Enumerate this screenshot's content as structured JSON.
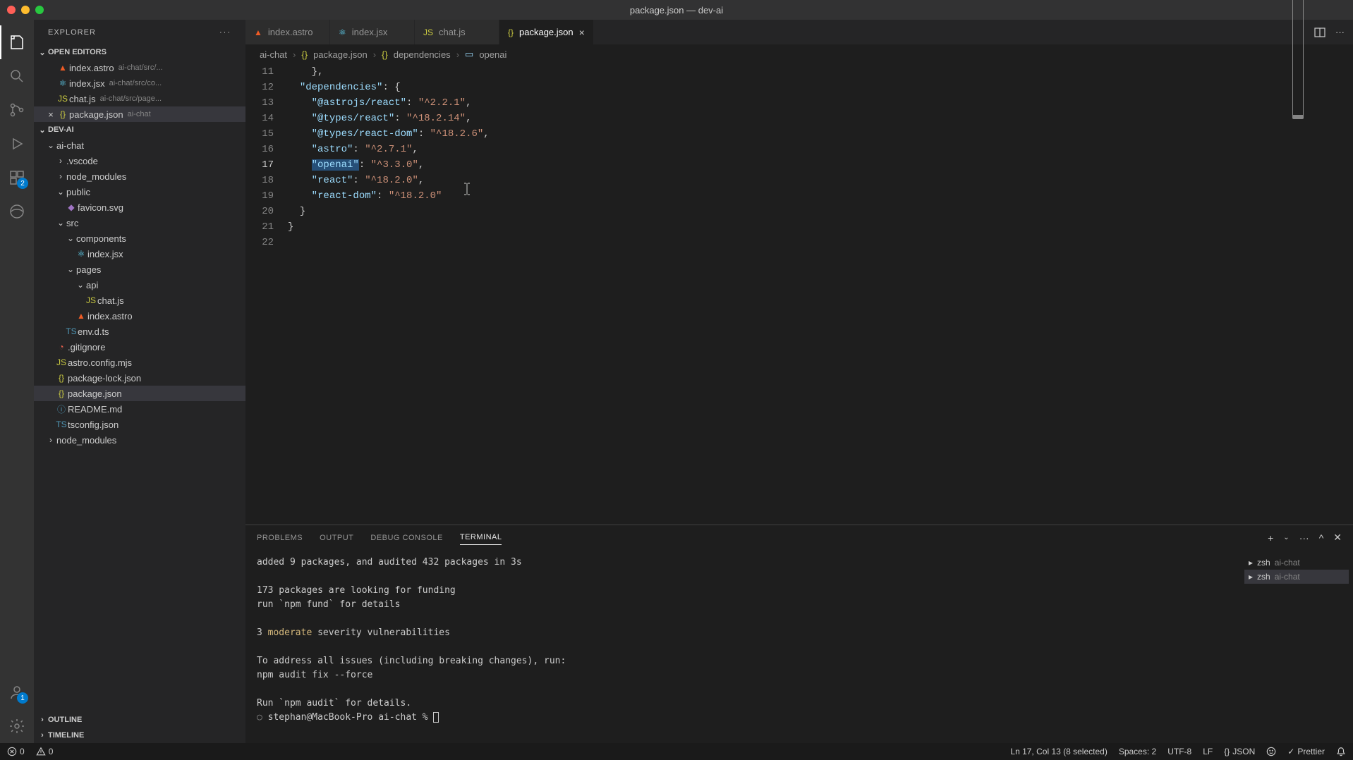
{
  "window": {
    "title": "package.json — dev-ai"
  },
  "sidebar": {
    "title": "EXPLORER",
    "open_editors_label": "OPEN EDITORS",
    "project_label": "DEV-AI",
    "outline_label": "OUTLINE",
    "timeline_label": "TIMELINE",
    "open_editors": [
      {
        "name": "index.astro",
        "hint": "ai-chat/src/...",
        "icon": "astro"
      },
      {
        "name": "index.jsx",
        "hint": "ai-chat/src/co...",
        "icon": "react"
      },
      {
        "name": "chat.js",
        "hint": "ai-chat/src/page...",
        "icon": "js"
      },
      {
        "name": "package.json",
        "hint": "ai-chat",
        "icon": "json",
        "active": true
      }
    ],
    "tree": [
      {
        "name": "ai-chat",
        "indent": 1,
        "folder": true,
        "open": true
      },
      {
        "name": ".vscode",
        "indent": 2,
        "folder": true
      },
      {
        "name": "node_modules",
        "indent": 2,
        "folder": true
      },
      {
        "name": "public",
        "indent": 2,
        "folder": true,
        "open": true
      },
      {
        "name": "favicon.svg",
        "indent": 3,
        "icon": "svg"
      },
      {
        "name": "src",
        "indent": 2,
        "folder": true,
        "open": true
      },
      {
        "name": "components",
        "indent": 3,
        "folder": true,
        "open": true
      },
      {
        "name": "index.jsx",
        "indent": 4,
        "icon": "react"
      },
      {
        "name": "pages",
        "indent": 3,
        "folder": true,
        "open": true
      },
      {
        "name": "api",
        "indent": 4,
        "folder": true,
        "open": true
      },
      {
        "name": "chat.js",
        "indent": 5,
        "icon": "js"
      },
      {
        "name": "index.astro",
        "indent": 4,
        "icon": "astro"
      },
      {
        "name": "env.d.ts",
        "indent": 3,
        "icon": "ts"
      },
      {
        "name": ".gitignore",
        "indent": 2,
        "icon": "git"
      },
      {
        "name": "astro.config.mjs",
        "indent": 2,
        "icon": "js"
      },
      {
        "name": "package-lock.json",
        "indent": 2,
        "icon": "json"
      },
      {
        "name": "package.json",
        "indent": 2,
        "icon": "json",
        "selected": true
      },
      {
        "name": "README.md",
        "indent": 2,
        "icon": "info"
      },
      {
        "name": "tsconfig.json",
        "indent": 2,
        "icon": "ts"
      },
      {
        "name": "node_modules",
        "indent": 1,
        "folder": true
      }
    ]
  },
  "activitybar": {
    "ext_badge": "2",
    "account_badge": "1"
  },
  "tabs": [
    {
      "name": "index.astro",
      "icon": "astro"
    },
    {
      "name": "index.jsx",
      "icon": "react"
    },
    {
      "name": "chat.js",
      "icon": "js"
    },
    {
      "name": "package.json",
      "icon": "json",
      "active": true
    }
  ],
  "breadcrumb": {
    "p0": "ai-chat",
    "p1": "package.json",
    "p2": "dependencies",
    "p3": "openai"
  },
  "editor": {
    "lines": [
      {
        "n": 11,
        "pre": "    ",
        "raw": "},"
      },
      {
        "n": 12,
        "pre": "  ",
        "key": "dependencies",
        "after": ": {"
      },
      {
        "n": 13,
        "pre": "    ",
        "key": "@astrojs/react",
        "val": "^2.2.1",
        "comma": true
      },
      {
        "n": 14,
        "pre": "    ",
        "key": "@types/react",
        "val": "^18.2.14",
        "comma": true
      },
      {
        "n": 15,
        "pre": "    ",
        "key": "@types/react-dom",
        "val": "^18.2.6",
        "comma": true
      },
      {
        "n": 16,
        "pre": "    ",
        "key": "astro",
        "val": "^2.7.1",
        "comma": true
      },
      {
        "n": 17,
        "pre": "    ",
        "key": "openai",
        "val": "^3.3.0",
        "comma": true,
        "selected": true
      },
      {
        "n": 18,
        "pre": "    ",
        "key": "react",
        "val": "^18.2.0",
        "comma": true
      },
      {
        "n": 19,
        "pre": "    ",
        "key": "react-dom",
        "val": "^18.2.0"
      },
      {
        "n": 20,
        "pre": "  ",
        "raw": "}"
      },
      {
        "n": 21,
        "pre": "",
        "raw": "}"
      },
      {
        "n": 22,
        "pre": "",
        "raw": ""
      }
    ]
  },
  "panel": {
    "tabs": {
      "problems": "PROBLEMS",
      "output": "OUTPUT",
      "debug": "DEBUG CONSOLE",
      "terminal": "TERMINAL"
    },
    "terminals": [
      {
        "shell": "zsh",
        "cwd": "ai-chat"
      },
      {
        "shell": "zsh",
        "cwd": "ai-chat",
        "active": true
      }
    ],
    "terminal_lines": [
      "added 9 packages, and audited 432 packages in 3s",
      "",
      "173 packages are looking for funding",
      "  run `npm fund` for details",
      "",
      "3 <moderate> severity vulnerabilities",
      "",
      "To address all issues (including breaking changes), run:",
      "  npm audit fix --force",
      "",
      "Run `npm audit` for details.",
      "stephan@MacBook-Pro ai-chat % "
    ]
  },
  "statusbar": {
    "errors": "0",
    "warnings": "0",
    "cursor": "Ln 17, Col 13 (8 selected)",
    "spaces": "Spaces: 2",
    "encoding": "UTF-8",
    "eol": "LF",
    "lang": "JSON",
    "prettier": "Prettier"
  }
}
